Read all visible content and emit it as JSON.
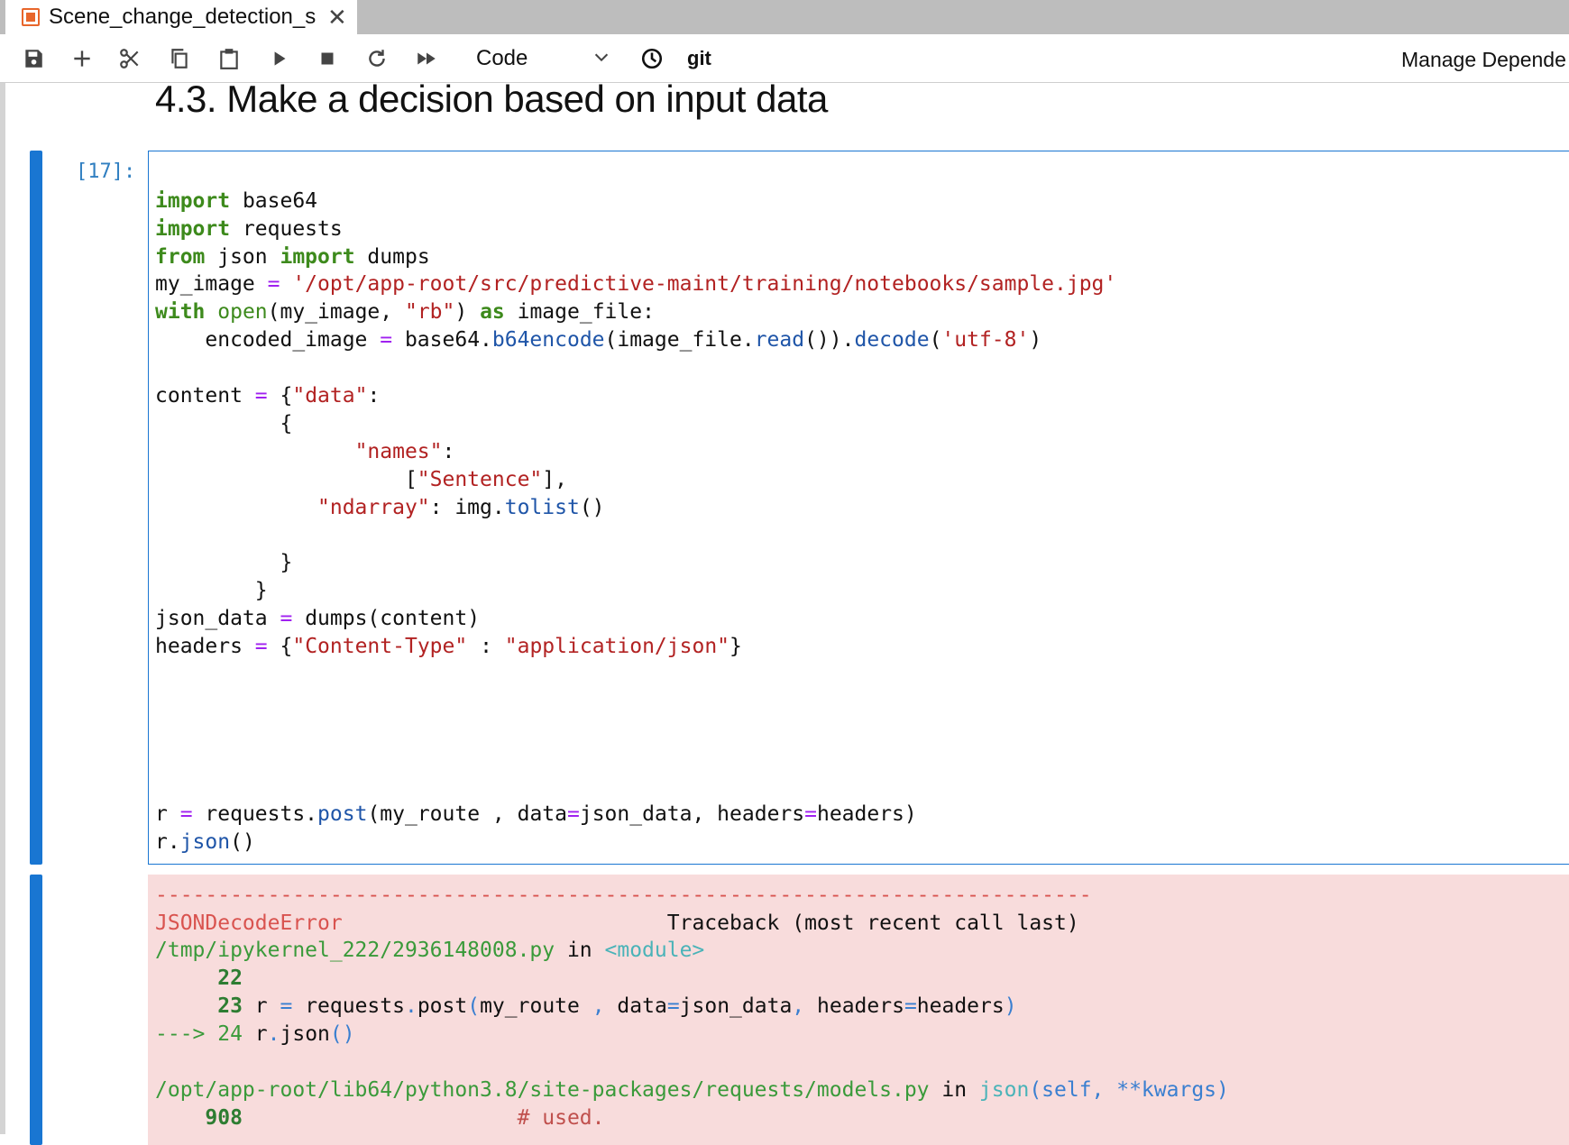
{
  "tab": {
    "title": "Scene_change_detection_s",
    "close_glyph": "✕",
    "icon": "notebook-icon"
  },
  "toolbar": {
    "buttons": [
      "save-icon",
      "add-cell-icon",
      "cut-icon",
      "copy-icon",
      "paste-icon",
      "run-icon",
      "stop-icon",
      "restart-icon",
      "fast-forward-icon"
    ],
    "cell_type": "Code",
    "git_label": "git",
    "manage_label": "Manage Depende"
  },
  "notebook": {
    "heading": "4.3. Make a decision based on input data",
    "cell": {
      "prompt": "[17]:",
      "code": {
        "l1_kw": "import",
        "l1_rest": " base64",
        "l2_kw": "import",
        "l2_rest": " requests",
        "l3_kw1": "from",
        "l3_mid": " json ",
        "l3_kw2": "import",
        "l3_rest": " dumps",
        "l4_a": "my_image ",
        "l4_op": "=",
        "l4_str": " '/opt/app-root/src/predictive-maint/training/notebooks/sample.jpg'",
        "l5_kw": "with",
        "l5_sp": " ",
        "l5_bi": "open",
        "l5_a": "(my_image, ",
        "l5_str": "\"rb\"",
        "l5_b": ") ",
        "l5_kw2": "as",
        "l5_c": " image_file:",
        "l6_a": "    encoded_image ",
        "l6_op": "=",
        "l6_b": " base64.",
        "l6_fn1": "b64encode",
        "l6_c": "(image_file.",
        "l6_fn2": "read",
        "l6_d": "()).",
        "l6_fn3": "decode",
        "l6_e": "(",
        "l6_str": "'utf-8'",
        "l6_f": ")",
        "l7_a": "content ",
        "l7_op": "=",
        "l7_b": " {",
        "l7_str": "\"data\"",
        "l7_c": ":",
        "l8": "          {",
        "l9_a": "                ",
        "l9_str": "\"names\"",
        "l9_b": ":",
        "l10_a": "                    [",
        "l10_str": "\"Sentence\"",
        "l10_b": "],",
        "l11_a": "             ",
        "l11_str": "\"ndarray\"",
        "l11_b": ": img.",
        "l11_fn": "tolist",
        "l11_c": "()",
        "l12": "          }",
        "l13": "        }",
        "l14_a": "json_data ",
        "l14_op": "=",
        "l14_b": " dumps(content)",
        "l15_a": "headers ",
        "l15_op": "=",
        "l15_b": " {",
        "l15_str1": "\"Content-Type\"",
        "l15_c": " : ",
        "l15_str2": "\"application/json\"",
        "l15_d": "}",
        "l16_a": "r ",
        "l16_op": "=",
        "l16_b": " requests.",
        "l16_fn": "post",
        "l16_c": "(my_route , data",
        "l16_op2": "=",
        "l16_d": "json_data, headers",
        "l16_op3": "=",
        "l16_e": "headers)",
        "l17_a": "r.",
        "l17_fn": "json",
        "l17_b": "()"
      }
    },
    "output": {
      "dashes": "---------------------------------------------------------------------------",
      "err_name": "JSONDecodeError",
      "traceback": "                          Traceback (most recent call last)",
      "file1": "/tmp/ipykernel_222/2936148008.py",
      "in1": " in ",
      "module": "<module>",
      "n22": "     22",
      "n23": "     23",
      "l23_a": " r ",
      "l23_op": "=",
      "l23_b": " requests",
      "l23_dot": ".",
      "l23_c": "post",
      "l23_p1": "(",
      "l23_d": "my_route ",
      "l23_comma": ",",
      "l23_e": " data",
      "l23_op2": "=",
      "l23_f": "json_data",
      "l23_comma2": ",",
      "l23_g": " headers",
      "l23_op3": "=",
      "l23_h": "headers",
      "l23_p2": ")",
      "arrow": "---> 24",
      "l24_a": " r",
      "l24_dot": ".",
      "l24_b": "json",
      "l24_p": "()",
      "file2": "/opt/app-root/lib64/python3.8/site-packages/requests/models.py",
      "in2": " in ",
      "func2": "json",
      "func2_args": "(self, **kwargs)",
      "n908": "    908",
      "c908": "                      # used."
    }
  }
}
